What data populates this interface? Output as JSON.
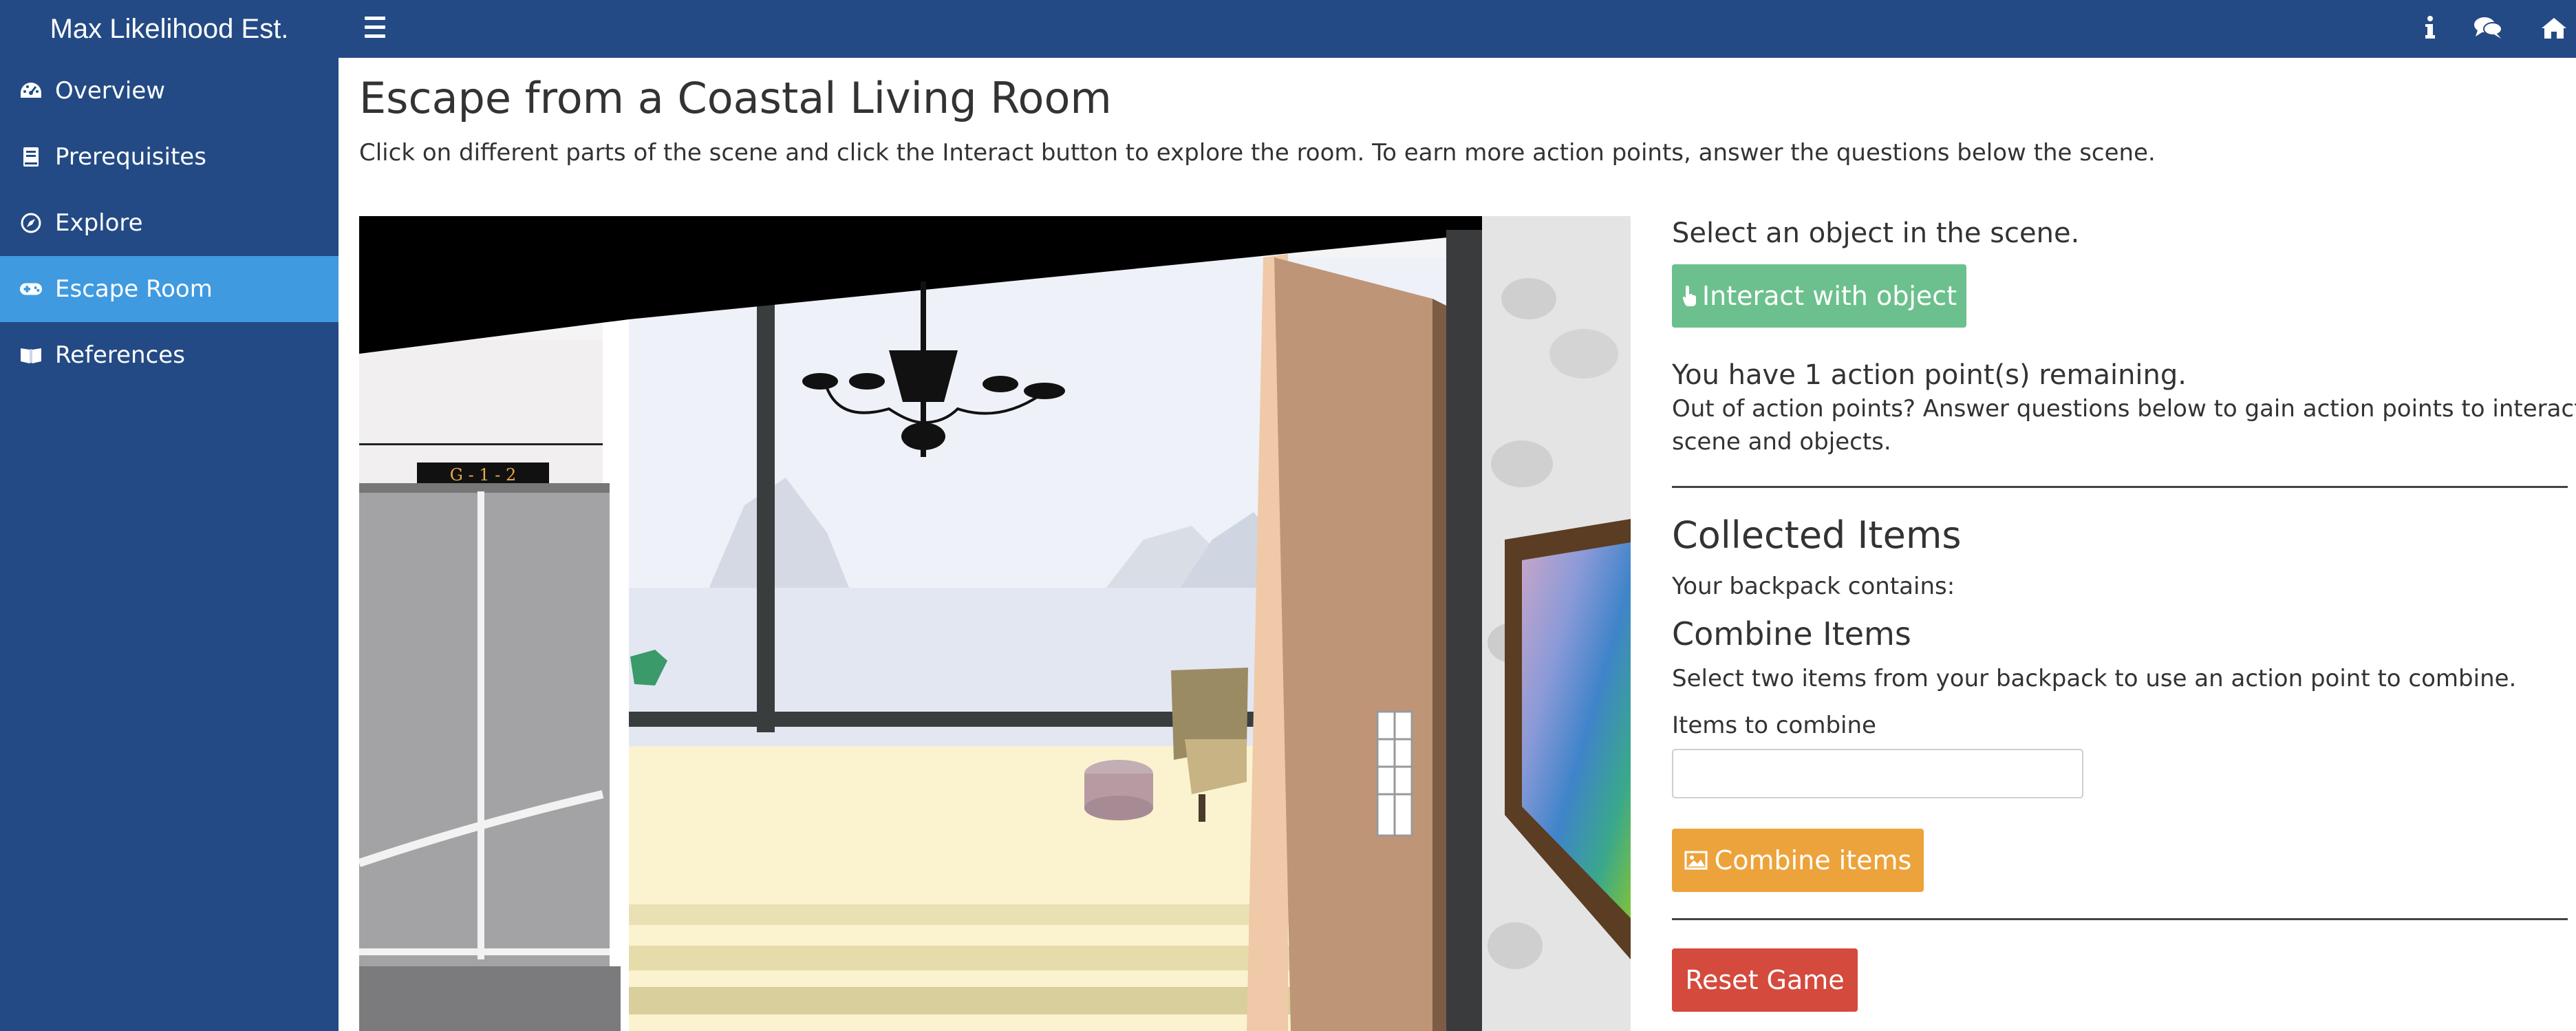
{
  "header": {
    "app_title": "Max Likelihood Est.",
    "menu_icon": "hamburger-icon",
    "right_icons": [
      "info-icon",
      "comments-icon",
      "home-icon"
    ]
  },
  "sidebar": {
    "items": [
      {
        "label": "Overview",
        "icon": "dashboard-icon",
        "active": false
      },
      {
        "label": "Prerequisites",
        "icon": "book-icon",
        "active": false
      },
      {
        "label": "Explore",
        "icon": "compass-icon",
        "active": false
      },
      {
        "label": "Escape Room",
        "icon": "gamepad-icon",
        "active": true
      },
      {
        "label": "References",
        "icon": "open-book-icon",
        "active": false
      }
    ]
  },
  "main": {
    "title": "Escape from a Coastal Living Room",
    "intro": "Click on different parts of the scene and click the Interact button to explore the room. To earn more action points, answer the questions below the scene.",
    "scene": {
      "sign_text": "G - 1 - 2"
    }
  },
  "panel": {
    "select_prompt": "Select an object in the scene.",
    "interact_button": "Interact with object",
    "action_points": "You have 1 action point(s) remaining.",
    "out_of_points_line1": "Out of action points? Answer questions below to gain action points to interact with the",
    "out_of_points_line2": "scene and objects.",
    "collected_heading": "Collected Items",
    "backpack_text": "Your backpack contains:",
    "combine_heading": "Combine Items",
    "combine_instructions": "Select two items from your backpack to use an action point to combine.",
    "combine_label": "Items to combine",
    "combine_value": "",
    "combine_button": "Combine items",
    "reset_button": "Reset Game"
  },
  "colors": {
    "navbar": "#234a84",
    "active_nav": "#3f9ae0",
    "interact_button": "#6cc08d",
    "combine_button": "#eda33b",
    "reset_button": "#d44a3d"
  }
}
